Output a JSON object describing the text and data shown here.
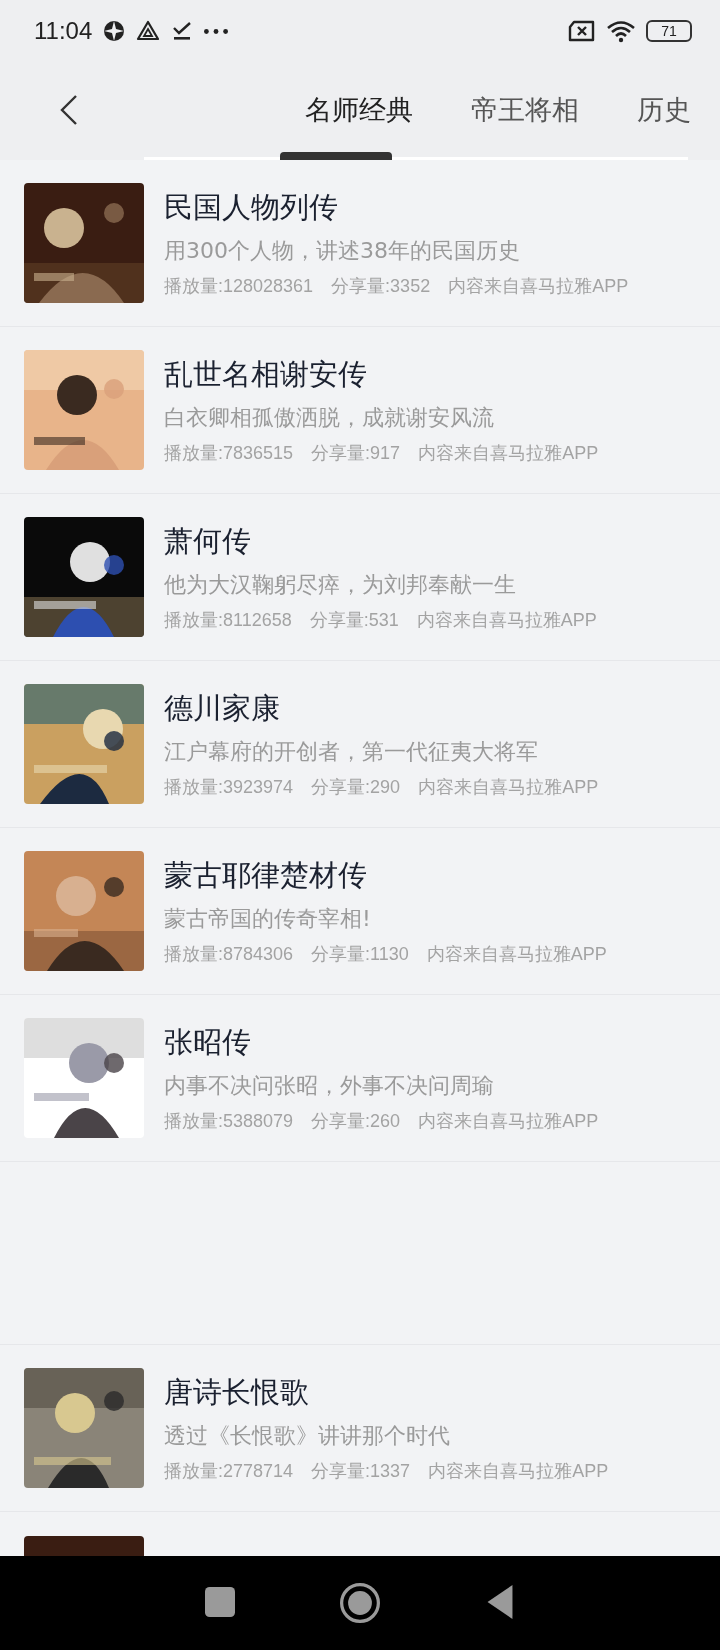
{
  "status_bar": {
    "time": "11:04",
    "battery": "71"
  },
  "header": {
    "tabs": [
      {
        "label": "名师经典",
        "selected": true
      },
      {
        "label": "帝王将相",
        "selected": false
      },
      {
        "label": "历史",
        "selected": false
      }
    ]
  },
  "list": {
    "items": [
      {
        "title": "民国人物列传",
        "subtitle": "用300个人物，讲述38年的民国历史",
        "plays": "播放量:128028361",
        "shares": "分享量:3352",
        "source": "内容来自喜马拉雅APP"
      },
      {
        "title": "乱世名相谢安传",
        "subtitle": "白衣卿相孤傲洒脱，成就谢安风流",
        "plays": "播放量:7836515",
        "shares": "分享量:917",
        "source": "内容来自喜马拉雅APP"
      },
      {
        "title": "萧何传",
        "subtitle": "他为大汉鞠躬尽瘁，为刘邦奉献一生",
        "plays": "播放量:8112658",
        "shares": "分享量:531",
        "source": "内容来自喜马拉雅APP"
      },
      {
        "title": "德川家康",
        "subtitle": "江户幕府的开创者，第一代征夷大将军",
        "plays": "播放量:3923974",
        "shares": "分享量:290",
        "source": "内容来自喜马拉雅APP"
      },
      {
        "title": "蒙古耶律楚材传",
        "subtitle": "蒙古帝国的传奇宰相!",
        "plays": "播放量:8784306",
        "shares": "分享量:1130",
        "source": "内容来自喜马拉雅APP"
      },
      {
        "title": "张昭传",
        "subtitle": "内事不决问张昭，外事不决问周瑜",
        "plays": "播放量:5388079",
        "shares": "分享量:260",
        "source": "内容来自喜马拉雅APP"
      },
      {
        "kind": "spacer"
      },
      {
        "title": "唐诗长恨歌",
        "subtitle": "透过《长恨歌》讲讲那个时代",
        "plays": "播放量:2778714",
        "shares": "分享量:1337",
        "source": "内容来自喜马拉雅APP"
      },
      {
        "kind": "partial"
      }
    ]
  }
}
